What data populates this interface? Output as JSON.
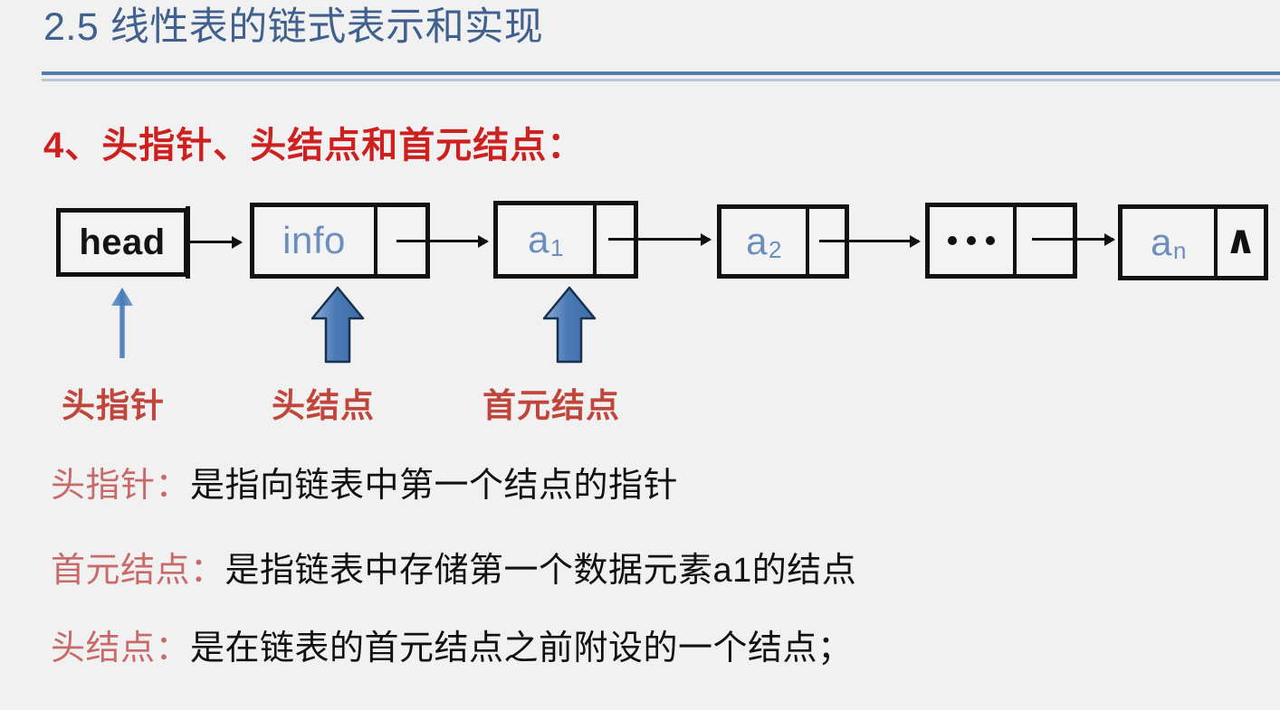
{
  "slide": {
    "title": "2.5 线性表的链式表示和实现",
    "section_heading": "4、头指针、头结点和首元结点：",
    "colors": {
      "background": "#f1f1f1",
      "title": "#40608e",
      "rule_thick": "#537eb4",
      "rule_thin": "#b9c7de",
      "heading_red": "#cf2020",
      "callout_red": "#c0463c",
      "term_red": "#c86a6a",
      "node_blue": "#6b8ebe",
      "arrow_blue": "#4a7ab5",
      "ink": "#111111"
    }
  },
  "diagram": {
    "head_box": {
      "label": "head"
    },
    "nodes": [
      {
        "name": "head-node",
        "data": "info",
        "sub": "",
        "pointer": "link"
      },
      {
        "name": "first-node",
        "data": "a",
        "sub": "1",
        "pointer": "link"
      },
      {
        "name": "second-node",
        "data": "a",
        "sub": "2",
        "pointer": "link"
      },
      {
        "name": "ellipsis-node",
        "data": "…",
        "sub": "",
        "pointer": "link"
      },
      {
        "name": "last-node",
        "data": "a",
        "sub": "n",
        "pointer": "null"
      }
    ],
    "null_marker": "∧"
  },
  "callouts": [
    {
      "label": "头指针",
      "arrow": "thin"
    },
    {
      "label": "头结点",
      "arrow": "block"
    },
    {
      "label": "首元结点",
      "arrow": "block"
    }
  ],
  "definitions": [
    {
      "term": "头指针：",
      "body": "是指向链表中第一个结点的指针",
      "sub_after": "",
      "tail": ""
    },
    {
      "term": "首元结点：",
      "body": "是指链表中存储第一个数据元素a",
      "sub_after": "1",
      "tail": "的结点"
    },
    {
      "term": "头结点：",
      "body": "是在链表的首元结点之前附设的一个结点；",
      "sub_after": "",
      "tail": ""
    }
  ]
}
